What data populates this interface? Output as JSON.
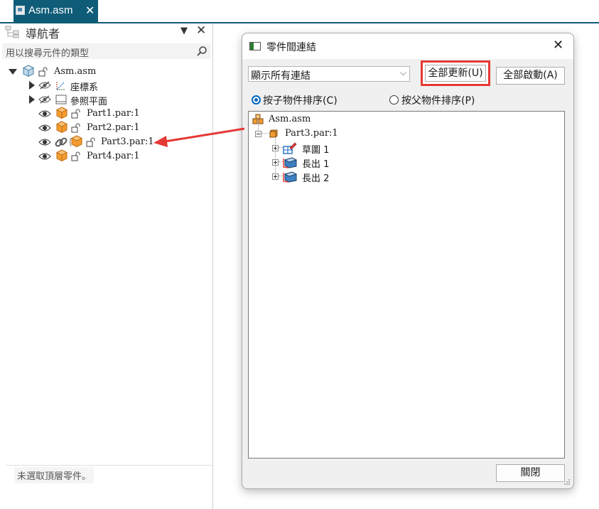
{
  "document_tab": {
    "label": "Asm.asm",
    "close_glyph": "✕"
  },
  "navigator": {
    "title": "導航者",
    "pin_glyph": "▼",
    "close_glyph": "✕",
    "search_placeholder": "用以搜尋元件的類型",
    "tree": {
      "root": "Asm.asm",
      "items": [
        {
          "label": "座標系"
        },
        {
          "label": "參照平面"
        },
        {
          "label": "Part1.par:1"
        },
        {
          "label": "Part2.par:1"
        },
        {
          "label": "Part3.par:1"
        },
        {
          "label": "Part4.par:1"
        }
      ]
    },
    "status": "未選取頂層零件。"
  },
  "dialog": {
    "title": "零件間連結",
    "close_glyph": "✕",
    "filter_value": "顯示所有連結",
    "filter_chevron": "⌵",
    "update_all_label": "全部更新(U)",
    "activate_all_label": "全部啟動(A)",
    "radio_child_label": "按子物件排序(C)",
    "radio_parent_label": "按父物件排序(P)",
    "link_tree": {
      "root": "Asm.asm",
      "part": "Part3.par:1",
      "features": [
        "草圖 1",
        "長出 1",
        "長出 2"
      ]
    },
    "close_label": "關閉"
  },
  "colors": {
    "tab_accent": "#0f5c78",
    "highlight_box": "#e53935",
    "annotation_arrow": "#e53935",
    "radio_selected": "#0067c0",
    "part_orange": "#f39c32"
  }
}
